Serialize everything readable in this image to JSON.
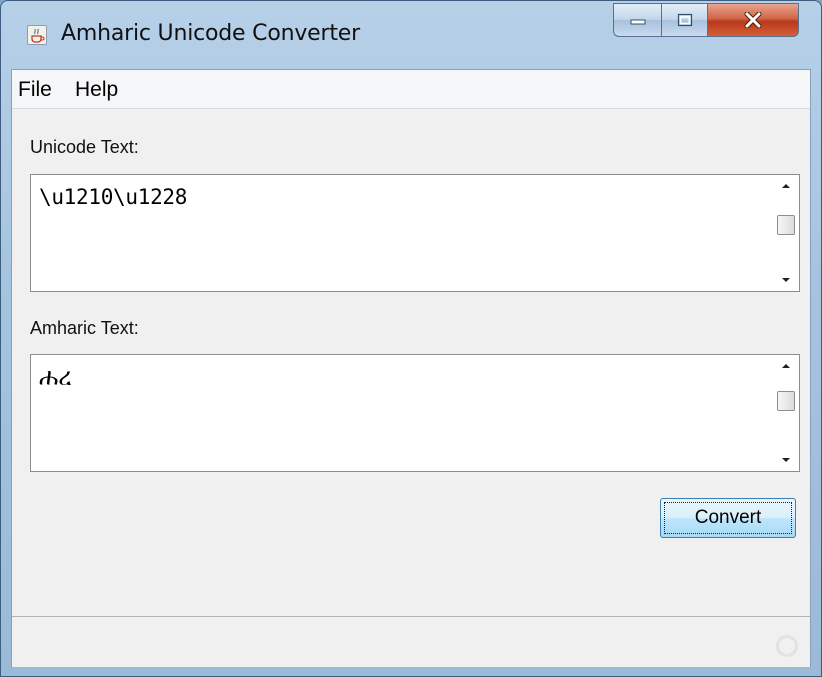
{
  "window": {
    "title": "Amharic Unicode Converter",
    "icon": "java-cup-icon"
  },
  "menu": {
    "items": [
      {
        "label": "File"
      },
      {
        "label": "Help"
      }
    ]
  },
  "unicode": {
    "label": "Unicode Text:",
    "value": "\\u1210\\u1228"
  },
  "amharic": {
    "label": "Amharic Text:",
    "value": "ሐረ"
  },
  "actions": {
    "convert_label": "Convert"
  },
  "colors": {
    "close_button": "#c74a25",
    "button_border": "#3c7fb1",
    "titlebar": "#a7c4df"
  }
}
